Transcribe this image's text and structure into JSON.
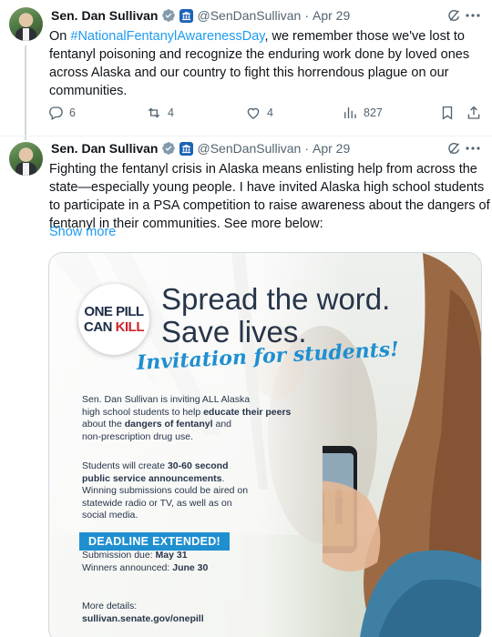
{
  "tweets": [
    {
      "author_name": "Sen. Dan Sullivan",
      "handle": "@SenDanSullivan",
      "date": "Apr 29",
      "text_lines": [
        {
          "pre": "On ",
          "hashtag": "#NationalFentanylAwarenessDay",
          "post": ", we remember those we've lost to"
        },
        {
          "pre": "fentanyl poisoning and recognize the enduring work done by loved ones"
        },
        {
          "pre": "across Alaska and our country to fight this horrendous plague on our"
        },
        {
          "pre": "communities."
        }
      ],
      "stats": {
        "replies": "6",
        "reposts": "4",
        "likes": "4",
        "views": "827"
      }
    },
    {
      "author_name": "Sen. Dan Sullivan",
      "handle": "@SenDanSullivan",
      "date": "Apr 29",
      "text_lines": [
        "Fighting the fentanyl crisis in Alaska means enlisting help from across the",
        "state—especially young people. I have invited Alaska high school students",
        "to participate in a PSA competition to raise awareness about the dangers of",
        "fentanyl in their communities. See more below:"
      ],
      "show_more": "Show more",
      "media": {
        "badge_line1": "ONE PILL",
        "badge_can": "CAN",
        "badge_kill": "KILL",
        "headline1": "Spread the word.",
        "headline2": "Save lives.",
        "invite": "Invitation for students!",
        "p1_a": "Sen. Dan Sullivan is inviting ALL Alaska",
        "p1_b": "high school students to help ",
        "p1_b_bold": "educate their peers",
        "p1_c": "about the ",
        "p1_c_bold": "dangers of fentanyl",
        "p1_c_end": " and",
        "p1_d": "non-prescription drug use.",
        "p2_a": "Students will create ",
        "p2_a_bold": "30-60 second",
        "p2_b_bold": "public service announcements",
        "p2_b_end": ".",
        "p2_c": "Winning submissions could be aired on",
        "p2_d": "statewide radio or TV, as well as on",
        "p2_e": "social media.",
        "deadline": "DEADLINE EXTENDED!",
        "sub_label": "Submission due: ",
        "sub_date": "May 31",
        "win_label": "Winners announced: ",
        "win_date": "June 30",
        "more_details": "More details:",
        "url": "sullivan.senate.gov/onepill"
      }
    }
  ],
  "icons": {
    "verified": "verified-badge-icon",
    "gov": "government-label-icon",
    "grok": "grok-icon",
    "more": "more-options-icon",
    "reply": "reply-icon",
    "repost": "repost-icon",
    "like": "like-icon",
    "views": "views-icon",
    "bookmark": "bookmark-icon",
    "share": "share-icon"
  },
  "colors": {
    "accent": "#1d9bf0",
    "muted": "#536471",
    "brand_blue": "#1f8fd0",
    "badge_red": "#d0232a"
  }
}
